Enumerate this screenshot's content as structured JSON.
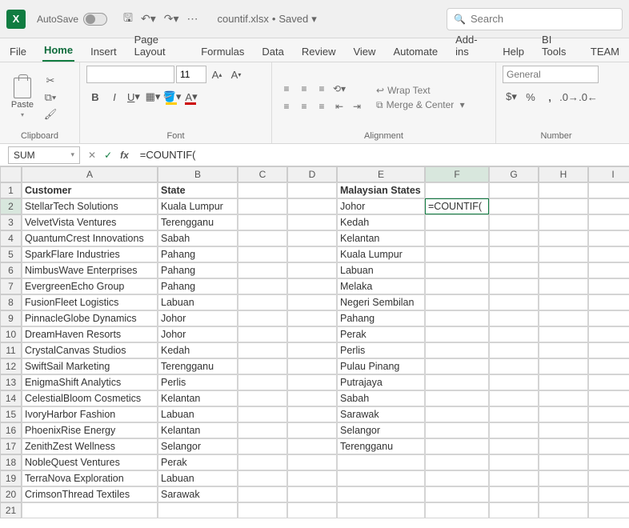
{
  "titlebar": {
    "autosave": "AutoSave",
    "filename": "countif.xlsx",
    "status": "Saved",
    "search_placeholder": "Search"
  },
  "tabs": [
    "File",
    "Home",
    "Insert",
    "Page Layout",
    "Formulas",
    "Data",
    "Review",
    "View",
    "Automate",
    "Add-ins",
    "Help",
    "BI Tools",
    "TEAM"
  ],
  "activeTab": "Home",
  "ribbon": {
    "clipboard_label": "Clipboard",
    "paste_label": "Paste",
    "font_label": "Font",
    "font_size": "11",
    "alignment_label": "Alignment",
    "wrap_text": "Wrap Text",
    "merge_center": "Merge & Center",
    "number_label": "Number",
    "number_format": "General"
  },
  "formula_bar": {
    "namebox": "SUM",
    "formula": "=COUNTIF("
  },
  "grid": {
    "columns": [
      "A",
      "B",
      "C",
      "D",
      "E",
      "F",
      "G",
      "H",
      "I"
    ],
    "active_col": "F",
    "active_row": 2,
    "rows": [
      {
        "n": 1,
        "A": "Customer",
        "B": "State",
        "E": "Malaysian States",
        "bold": true
      },
      {
        "n": 2,
        "A": "StellarTech Solutions",
        "B": "Kuala Lumpur",
        "E": "Johor",
        "F": "=COUNTIF("
      },
      {
        "n": 3,
        "A": "VelvetVista Ventures",
        "B": "Terengganu",
        "E": "Kedah"
      },
      {
        "n": 4,
        "A": "QuantumCrest Innovations",
        "B": "Sabah",
        "E": "Kelantan"
      },
      {
        "n": 5,
        "A": "SparkFlare Industries",
        "B": "Pahang",
        "E": "Kuala Lumpur"
      },
      {
        "n": 6,
        "A": "NimbusWave Enterprises",
        "B": "Pahang",
        "E": "Labuan"
      },
      {
        "n": 7,
        "A": "EvergreenEcho Group",
        "B": "Pahang",
        "E": "Melaka"
      },
      {
        "n": 8,
        "A": "FusionFleet Logistics",
        "B": "Labuan",
        "E": "Negeri Sembilan"
      },
      {
        "n": 9,
        "A": "PinnacleGlobe Dynamics",
        "B": "Johor",
        "E": "Pahang"
      },
      {
        "n": 10,
        "A": "DreamHaven Resorts",
        "B": "Johor",
        "E": "Perak"
      },
      {
        "n": 11,
        "A": "CrystalCanvas Studios",
        "B": "Kedah",
        "E": "Perlis"
      },
      {
        "n": 12,
        "A": "SwiftSail Marketing",
        "B": "Terengganu",
        "E": "Pulau Pinang"
      },
      {
        "n": 13,
        "A": "EnigmaShift Analytics",
        "B": "Perlis",
        "E": "Putrajaya"
      },
      {
        "n": 14,
        "A": "CelestialBloom Cosmetics",
        "B": "Kelantan",
        "E": "Sabah"
      },
      {
        "n": 15,
        "A": "IvoryHarbor Fashion",
        "B": "Labuan",
        "E": "Sarawak"
      },
      {
        "n": 16,
        "A": "PhoenixRise Energy",
        "B": "Kelantan",
        "E": "Selangor"
      },
      {
        "n": 17,
        "A": "ZenithZest Wellness",
        "B": "Selangor",
        "E": "Terengganu"
      },
      {
        "n": 18,
        "A": "NobleQuest Ventures",
        "B": "Perak"
      },
      {
        "n": 19,
        "A": "TerraNova Exploration",
        "B": "Labuan"
      },
      {
        "n": 20,
        "A": "CrimsonThread Textiles",
        "B": "Sarawak"
      },
      {
        "n": 21
      }
    ]
  }
}
